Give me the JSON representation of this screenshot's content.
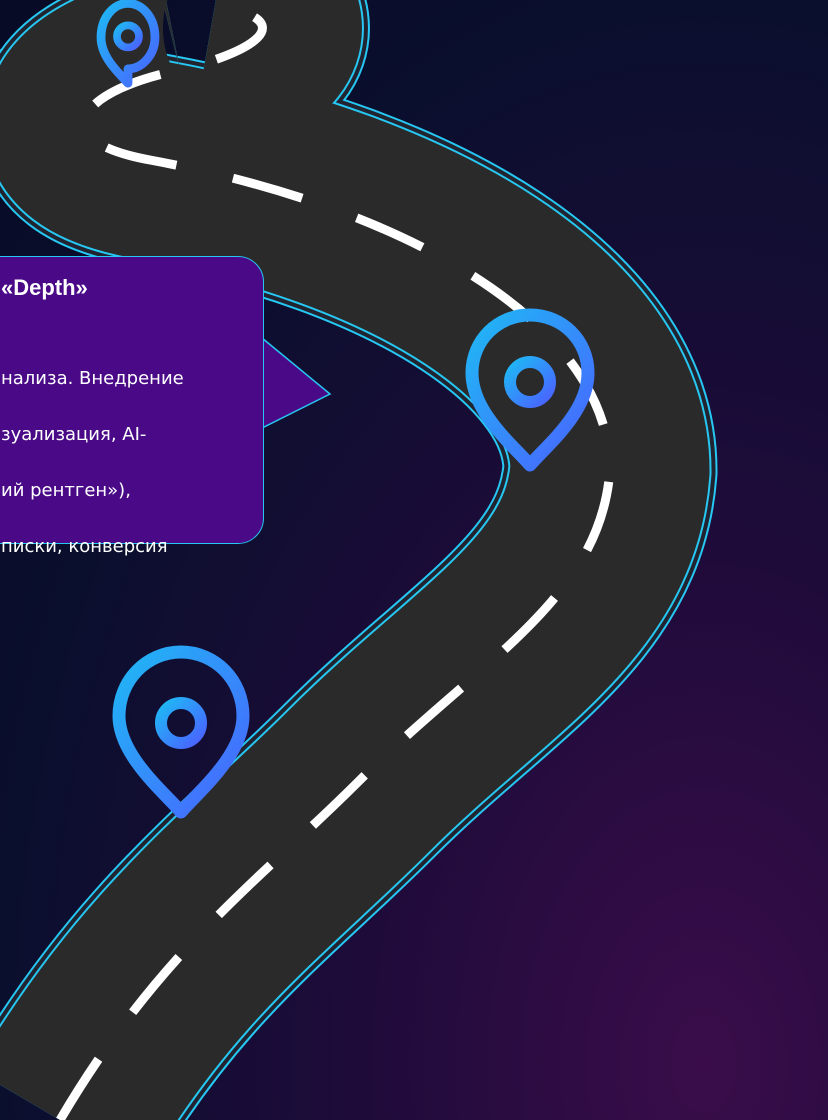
{
  "callout": {
    "title": "«Depth»",
    "body_lines": [
      "нализа. Внедрение",
      "зуализация, AI-",
      "ий рентген»),",
      "писки, конверсия"
    ]
  },
  "pins": [
    {
      "name": "map-pin-far"
    },
    {
      "name": "map-pin-middle"
    },
    {
      "name": "map-pin-near"
    }
  ],
  "colors": {
    "background": "#0b0f2e",
    "road": "#272727",
    "road_edge": "#26c7f2",
    "lane_marking": "#ffffff",
    "callout_fill": "#4a0a88",
    "pin_gradient_start": "#1fb8f5",
    "pin_gradient_end": "#4a62ff"
  }
}
